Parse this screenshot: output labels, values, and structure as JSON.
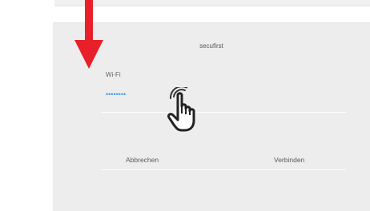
{
  "dialog": {
    "title": "secufirst",
    "field_label": "Wi-Fi",
    "password_value": "••••••••",
    "cancel_label": "Abbrechen",
    "connect_label": "Verbinden"
  },
  "overlay": {
    "arrow_color": "#e8202a",
    "hand_icon": "pointing-hand-icon",
    "arrow_icon": "down-arrow-icon"
  },
  "colors": {
    "dialog_bg": "#ededed",
    "password_accent": "#3a9be0"
  }
}
